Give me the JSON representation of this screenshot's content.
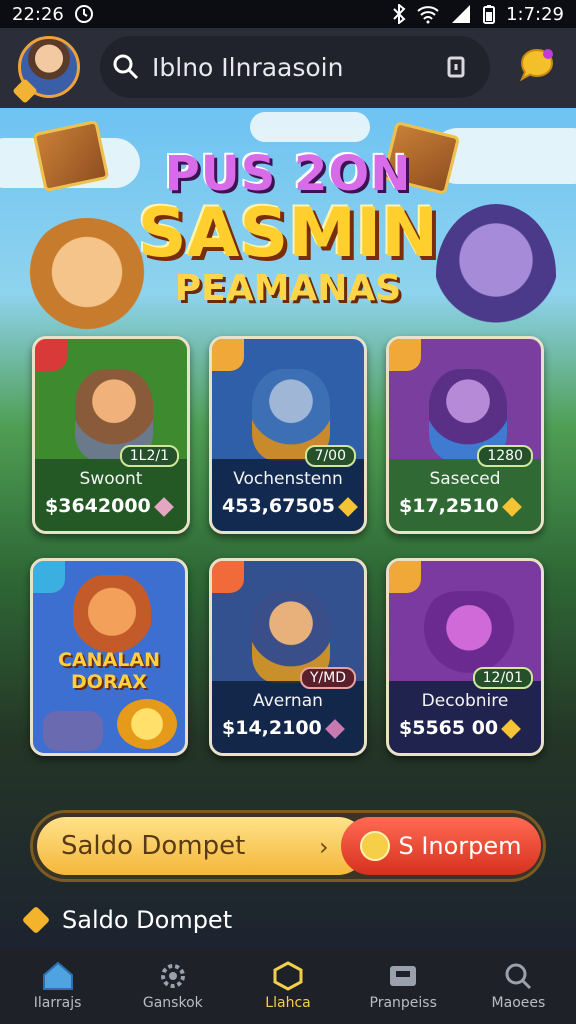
{
  "status_bar": {
    "time_left": "22:26",
    "time_right": "1:7:29"
  },
  "search": {
    "value": "Iblno Ilnraasoin"
  },
  "hero": {
    "title_line1": "PUS 2ON",
    "title_line2": "SASMIN",
    "title_line3": "PEAMANAS"
  },
  "cards": [
    {
      "name": "Swoont",
      "price": "$3642000",
      "badge": "1L2/1",
      "bg": "#3e8a2e"
    },
    {
      "name": "Vochenstenn",
      "price": "453,67505",
      "badge": "7/00",
      "bg": "#2f5fa9"
    },
    {
      "name": "Saseced",
      "price": "$17,2510",
      "badge": "1280",
      "bg": "#7a3f9e"
    },
    {
      "name": "CANALAN\nDORAX",
      "price": "",
      "badge": "",
      "bg": "#3d6fd0"
    },
    {
      "name": "Avernan",
      "price": "$14,2100",
      "badge": "Y/MD",
      "bg": "#33508f"
    },
    {
      "name": "Decobnire",
      "price": "$5565 00",
      "badge": "12/01",
      "bg": "#7b3aa0"
    }
  ],
  "wallet": {
    "left_label": "Saldo Dompet",
    "right_label": "S Inorpem"
  },
  "saldo": {
    "label": "Saldo Dompet"
  },
  "nav": {
    "items": [
      {
        "label": "Ilarrajs",
        "icon": "home-icon"
      },
      {
        "label": "Ganskok",
        "icon": "gear-icon"
      },
      {
        "label": "Llahca",
        "icon": "hexagon-icon"
      },
      {
        "label": "Pranpeiss",
        "icon": "ticket-icon"
      },
      {
        "label": "Maoees",
        "icon": "search-icon"
      }
    ],
    "active_index": 2
  }
}
